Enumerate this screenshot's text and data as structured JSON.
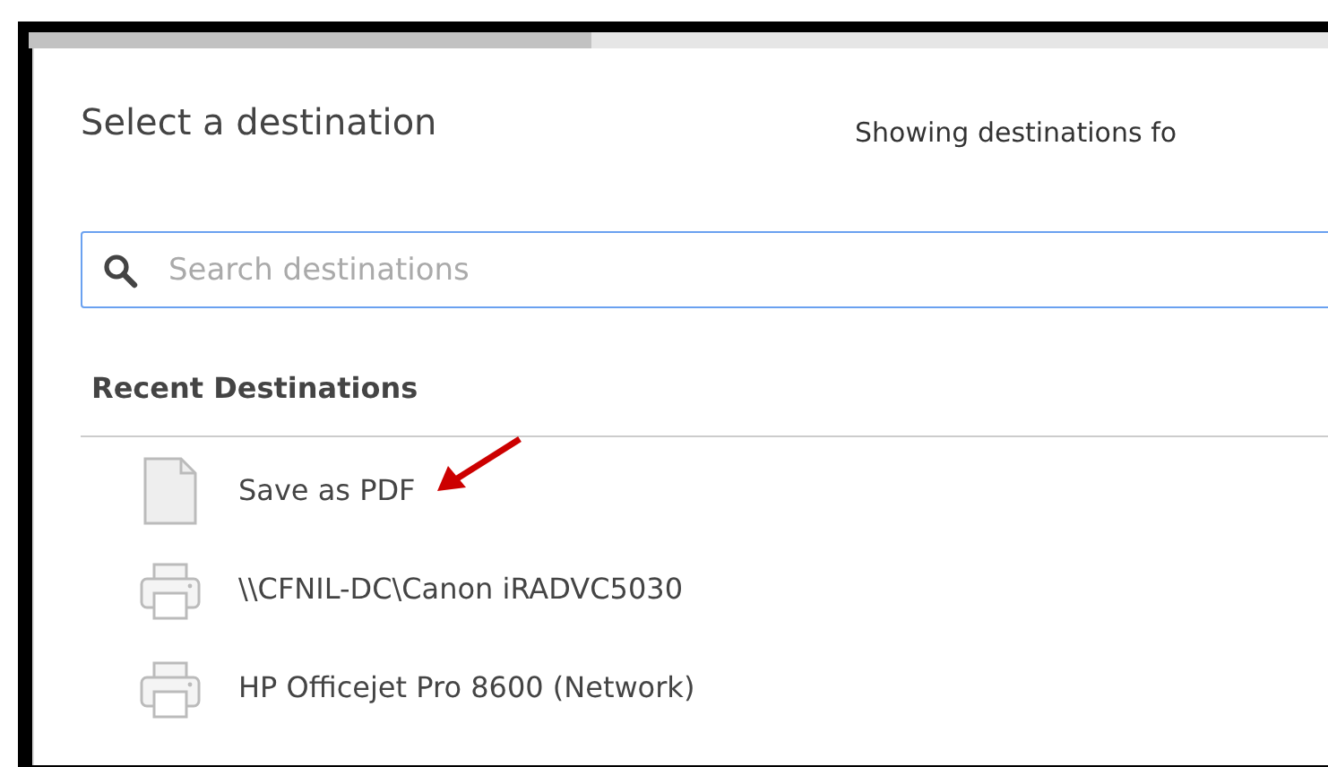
{
  "dialog": {
    "title": "Select a destination",
    "subtitle": "Showing destinations fo"
  },
  "search": {
    "placeholder": "Search destinations"
  },
  "section": {
    "heading": "Recent Destinations"
  },
  "destinations": [
    {
      "kind": "pdf",
      "label": "Save as PDF",
      "marked": true
    },
    {
      "kind": "printer",
      "label": "\\\\CFNIL-DC\\Canon iRADVC5030",
      "marked": false
    },
    {
      "kind": "printer",
      "label": "HP Officejet Pro 8600 (Network)",
      "marked": false
    }
  ]
}
